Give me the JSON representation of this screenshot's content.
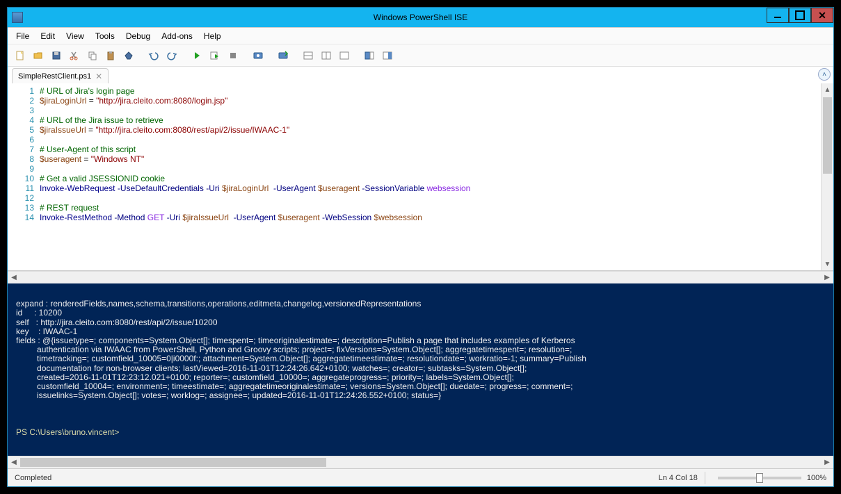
{
  "window": {
    "title": "Windows PowerShell ISE"
  },
  "menu": {
    "items": [
      "File",
      "Edit",
      "View",
      "Tools",
      "Debug",
      "Add-ons",
      "Help"
    ]
  },
  "tab": {
    "label": "SimpleRestClient.ps1"
  },
  "code": {
    "lines": [
      {
        "n": "1",
        "t": "comment",
        "text": "# URL of Jira's login page"
      },
      {
        "n": "2",
        "t": "assign",
        "var": "$jiraLoginUrl",
        "eq": " = ",
        "str": "\"http://jira.cleito.com:8080/login.jsp\""
      },
      {
        "n": "3",
        "t": "blank",
        "text": ""
      },
      {
        "n": "4",
        "t": "comment",
        "text": "# URL of the Jira issue to retrieve"
      },
      {
        "n": "5",
        "t": "assign",
        "var": "$jiraIssueUrl",
        "eq": " = ",
        "str": "\"http://jira.cleito.com:8080/rest/api/2/issue/IWAAC-1\""
      },
      {
        "n": "6",
        "t": "blank",
        "text": ""
      },
      {
        "n": "7",
        "t": "comment",
        "text": "# User-Agent of this script"
      },
      {
        "n": "8",
        "t": "assign",
        "var": "$useragent",
        "eq": " = ",
        "str": "\"Windows NT\""
      },
      {
        "n": "9",
        "t": "blank",
        "text": ""
      },
      {
        "n": "10",
        "t": "comment",
        "text": "# Get a valid JSESSIONID cookie"
      },
      {
        "n": "11",
        "t": "cmd",
        "cmd": "Invoke-WebRequest",
        "rest": [
          " ",
          "-UseDefaultCredentials",
          " ",
          "-Uri",
          " ",
          "$jiraLoginUrl",
          "  ",
          "-UserAgent",
          " ",
          "$useragent",
          " ",
          "-SessionVariable",
          " ",
          "websession"
        ]
      },
      {
        "n": "12",
        "t": "blank",
        "text": ""
      },
      {
        "n": "13",
        "t": "comment",
        "text": "# REST request"
      },
      {
        "n": "14",
        "t": "cmd",
        "cmd": "Invoke-RestMethod",
        "rest": [
          " ",
          "-Method",
          " ",
          "GET",
          " ",
          "-Uri",
          " ",
          "$jiraIssueUrl",
          "  ",
          "-UserAgent",
          " ",
          "$useragent",
          " ",
          "-WebSession",
          " ",
          "$websession"
        ]
      }
    ]
  },
  "console": {
    "output": "\nexpand : renderedFields,names,schema,transitions,operations,editmeta,changelog,versionedRepresentations\nid     : 10200\nself   : http://jira.cleito.com:8080/rest/api/2/issue/10200\nkey    : IWAAC-1\nfields : @{issuetype=; components=System.Object[]; timespent=; timeoriginalestimate=; description=Publish a page that includes examples of Kerberos\n         authentication via IWAAC from PowerShell, Python and Groovy scripts; project=; fixVersions=System.Object[]; aggregatetimespent=; resolution=;\n         timetracking=; customfield_10005=0|i0000f:; attachment=System.Object[]; aggregatetimeestimate=; resolutiondate=; workratio=-1; summary=Publish\n         documentation for non-browser clients; lastViewed=2016-11-01T12:24:26.642+0100; watches=; creator=; subtasks=System.Object[];\n         created=2016-11-01T12:23:12.021+0100; reporter=; customfield_10000=; aggregateprogress=; priority=; labels=System.Object[];\n         customfield_10004=; environment=; timeestimate=; aggregatetimeoriginalestimate=; versions=System.Object[]; duedate=; progress=; comment=;\n         issuelinks=System.Object[]; votes=; worklog=; assignee=; updated=2016-11-01T12:24:26.552+0100; status=}\n\n\n\n",
    "prompt": "PS C:\\Users\\bruno.vincent> "
  },
  "status": {
    "message": "Completed",
    "position": "Ln 4  Col 18",
    "zoom": "100%"
  },
  "toolbar_icons": [
    "new-file-icon",
    "open-icon",
    "save-icon",
    "cut-icon",
    "copy-icon",
    "paste-icon",
    "clear-icon",
    "sep",
    "undo-icon",
    "redo-icon",
    "sep",
    "run-icon",
    "run-selection-icon",
    "stop-icon",
    "sep",
    "remote-icon",
    "sep",
    "new-remote-tab-icon",
    "sep",
    "layout-split-icon",
    "layout-side-icon",
    "layout-full-icon",
    "sep",
    "show-command-icon",
    "show-addon-icon"
  ]
}
